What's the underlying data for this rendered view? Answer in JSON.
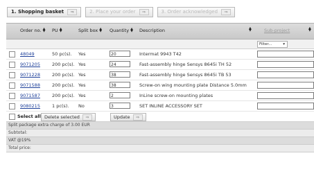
{
  "steps": [
    {
      "label": "1. Shopping basket",
      "state": "active"
    },
    {
      "label": "2. Place your order",
      "state": "disabled"
    },
    {
      "label": "3. Order acknowledged",
      "state": "disabled"
    }
  ],
  "arrow_glyph": "⇒",
  "columns": {
    "order_no": "Order no.",
    "pu": "PU",
    "split_box": "Split box",
    "quantity": "Quantity",
    "description": "Description",
    "sub_project": "Sub-project"
  },
  "filter": {
    "label": "Filter..."
  },
  "rows": [
    {
      "order_no": "48049",
      "pu": "50 pc(s).",
      "split": "Yes",
      "qty": "20",
      "desc": "Intermat 9943 T42"
    },
    {
      "order_no": "9071205",
      "pu": "200 pc(s).",
      "split": "Yes",
      "qty": "24",
      "desc": "Fast-assembly hinge Sensys 8645i TH 52"
    },
    {
      "order_no": "9071228",
      "pu": "200 pc(s).",
      "split": "Yes",
      "qty": "38",
      "desc": "Fast-assembly hinge Sensys 8645i TB 53"
    },
    {
      "order_no": "9071588",
      "pu": "200 pc(s).",
      "split": "Yes",
      "qty": "38",
      "desc": "Screw-on wing mounting plate Distance 5.0mm"
    },
    {
      "order_no": "9071587",
      "pu": "200 pc(s).",
      "split": "Yes",
      "qty": "2",
      "desc": "InLine screw-on mounting plates"
    },
    {
      "order_no": "9080215",
      "pu": "1 pc(s).",
      "split": "No",
      "qty": "3",
      "desc": "SET INLINE ACCESSORY SET"
    }
  ],
  "actions": {
    "select_all": "Select all",
    "delete_selected": "Delete selected",
    "update": "Update"
  },
  "summary": {
    "split_charge": "Split package extra charge of 3.00  EUR",
    "subtotal": "Subtotal:",
    "vat": "VAT @19%",
    "total": "Total price:"
  }
}
